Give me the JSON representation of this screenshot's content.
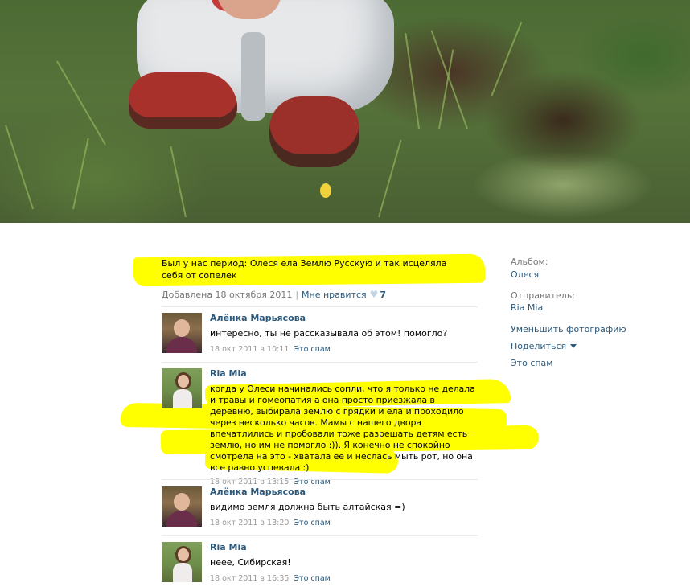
{
  "photo": {
    "icon": "photo-image"
  },
  "caption": {
    "text": "Был у нас период: Олеся ела Землю Русскую и так исцеляла себя от сопелек"
  },
  "meta": {
    "added": "Добавлена 18 октября 2011",
    "like_label": "Мне нравится",
    "like_count": "7",
    "icon": "heart-icon"
  },
  "comments": [
    {
      "author": "Алёнка Марьясова",
      "text": "интересно, ты не рассказывала об этом! помогло?",
      "date": "18 окт 2011 в 10:11",
      "spam": "Это спам"
    },
    {
      "author": "Ria Mia",
      "text": "когда у Олеси начинались сопли, что я только не делала и травы и гомеопатия а она просто приезжала в деревню, выбирала землю с грядки и ела и проходило через несколько часов. Мамы с нашего двора впечатлились и пробовали тоже разрешать детям есть землю, но им не помогло :)). Я конечно не спокойно смотрела на это - хватала ее и неслась мыть рот, но она все равно успевала :)",
      "date": "18 окт 2011 в 13:15",
      "spam": "Это спам"
    },
    {
      "author": "Алёнка Марьясова",
      "text": "видимо земля должна быть алтайская =)",
      "date": "18 окт 2011 в 13:20",
      "spam": "Это спам"
    },
    {
      "author": "Ria Mia",
      "text": "неее, Сибирская!",
      "date": "18 окт 2011 в 16:35",
      "spam": "Это спам"
    }
  ],
  "sidebar": {
    "album_label": "Альбом:",
    "album_value": "Олеся",
    "sender_label": "Отправитель:",
    "sender_value": "Ria Mia",
    "shrink": "Уменьшить фотографию",
    "share": "Поделиться",
    "spam": "Это спам"
  },
  "colors": {
    "link": "#2b587a",
    "highlight": "#ffff00",
    "muted": "#777777"
  }
}
